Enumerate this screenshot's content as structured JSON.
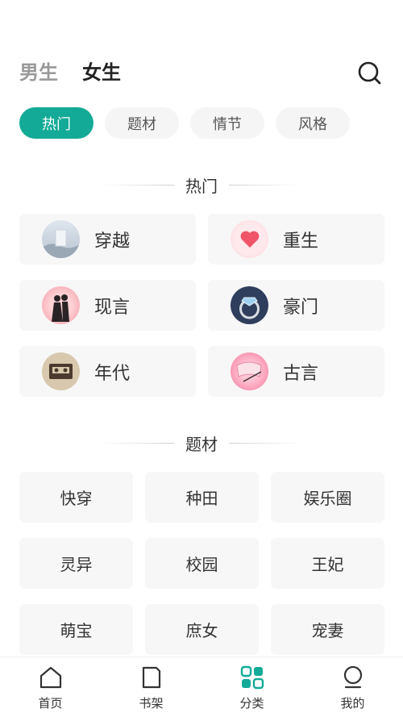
{
  "header": {
    "tabs": [
      {
        "label": "男生"
      },
      {
        "label": "女生"
      }
    ],
    "active_tab": 1
  },
  "chips": [
    {
      "label": "热门",
      "active": true
    },
    {
      "label": "题材",
      "active": false
    },
    {
      "label": "情节",
      "active": false
    },
    {
      "label": "风格",
      "active": false
    }
  ],
  "hot_section": {
    "title": "热门",
    "items": [
      {
        "label": "穿越",
        "icon": "door-icon"
      },
      {
        "label": "重生",
        "icon": "heart-icon"
      },
      {
        "label": "现言",
        "icon": "couple-icon"
      },
      {
        "label": "豪门",
        "icon": "ring-icon"
      },
      {
        "label": "年代",
        "icon": "cassette-icon"
      },
      {
        "label": "古言",
        "icon": "fan-icon"
      }
    ]
  },
  "topic_section": {
    "title": "题材",
    "items": [
      {
        "label": "快穿"
      },
      {
        "label": "种田"
      },
      {
        "label": "娱乐圈"
      },
      {
        "label": "灵异"
      },
      {
        "label": "校园"
      },
      {
        "label": "王妃"
      },
      {
        "label": "萌宝"
      },
      {
        "label": "庶女"
      },
      {
        "label": "宠妻"
      }
    ]
  },
  "bottom_nav": [
    {
      "label": "首页",
      "icon": "home-icon"
    },
    {
      "label": "书架",
      "icon": "bookshelf-icon"
    },
    {
      "label": "分类",
      "icon": "category-icon",
      "active": true
    },
    {
      "label": "我的",
      "icon": "profile-icon"
    }
  ],
  "colors": {
    "accent": "#13aa97",
    "text": "#333333",
    "muted": "#999999",
    "card": "#f7f7f7"
  }
}
